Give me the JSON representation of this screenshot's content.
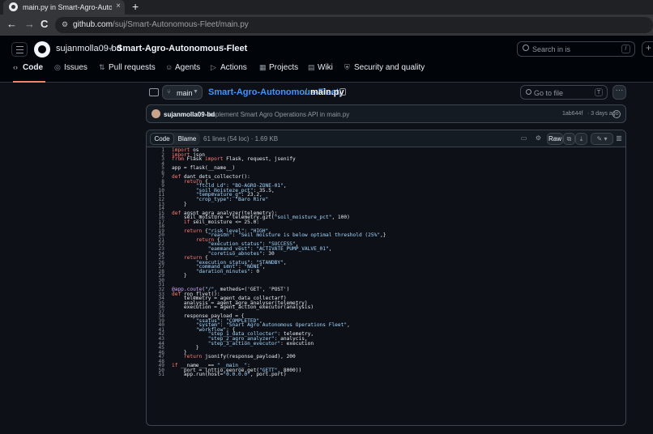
{
  "browser": {
    "tab_title": "main.py in Smart-Agro-Autonomous-Fleet",
    "tab_close": "×",
    "new_tab": "+",
    "url_host": "github.com",
    "url_path": "/suj/Smart-Autonomous-Fleet/main.py",
    "back": "←",
    "forward": "→",
    "reload": "C"
  },
  "header": {
    "owner": "sujanmolla09-bd",
    "separator": "/",
    "repo": "Smart-Agro-Autonomous-Fleet",
    "search_placeholder": "Search in is",
    "search_kbd": "/",
    "plus": "+"
  },
  "repo_tabs": [
    {
      "label": "Code",
      "icon": "‹›"
    },
    {
      "label": "Issues",
      "icon": "◎"
    },
    {
      "label": "Pull requests",
      "icon": "⇅"
    },
    {
      "label": "Agents",
      "icon": "☺"
    },
    {
      "label": "Actions",
      "icon": "▷"
    },
    {
      "label": "Projects",
      "icon": "▦"
    },
    {
      "label": "Wiki",
      "icon": "▤"
    },
    {
      "label": "Security and quality",
      "icon": "⛨"
    }
  ],
  "file_nav": {
    "branch": "main",
    "crumb_repo": "Smart-Agro-Autonomous-Fleet",
    "crumb_sep": "/",
    "crumb_file": "main.py",
    "goto_placeholder": "Go to file",
    "goto_kbd": "T",
    "more": "···"
  },
  "commit": {
    "author": "sujanmolla09-bd",
    "message": "Implement Smart Agro Operations API in main.py",
    "sha": "1ab644f",
    "time": "· 3 days ago"
  },
  "toolbar": {
    "code_label": "Code",
    "blame_label": "Blame",
    "file_info": "61 lines (54 loc) · 1.69 KB",
    "raw_label": "Raw"
  },
  "code": [
    {
      "n": "1",
      "t": "import os"
    },
    {
      "n": "2",
      "t": "import json"
    },
    {
      "n": "3",
      "t": "from Flask import Flask, request, jsenify"
    },
    {
      "n": "4",
      "t": ""
    },
    {
      "n": "5",
      "t": "app = flask(__name__)"
    },
    {
      "n": "6",
      "t": ""
    },
    {
      "n": "7",
      "t": "def dant_dets_collector():"
    },
    {
      "n": "8",
      "t": "    return {"
    },
    {
      "n": "9",
      "t": "        \"ftcld_Ld\": \"BO-AGRO-ZONE-01\","
    },
    {
      "n": "10",
      "t": "        \"soil_moisteze_pct\": 35.5,"
    },
    {
      "n": "11",
      "t": "        \"tempevature_g\": 23.2,"
    },
    {
      "n": "12",
      "t": "        \"crop_type\": \"Baro Rire\""
    },
    {
      "n": "13",
      "t": "    }"
    },
    {
      "n": "14",
      "t": ""
    },
    {
      "n": "15",
      "t": "def agsnt_agra_analyzer(telemetry):"
    },
    {
      "n": "16",
      "t": "    seil_moisture = telemetry.gzt(\"soil_moisture_pct\", 100)"
    },
    {
      "n": "17",
      "t": "    if seil_moisture <= 25.0:"
    },
    {
      "n": "18",
      "t": ""
    },
    {
      "n": "19",
      "t": "    return {\"risk_level\": \"HIGH\","
    },
    {
      "n": "20",
      "t": "            \"reason\": \"Seil moisture is below optimal threshold (25%\",}"
    },
    {
      "n": "21",
      "t": "        return {"
    },
    {
      "n": "22",
      "t": "            \"execution_status\": \"SUCCESS\","
    },
    {
      "n": "23",
      "t": "            \"eammand_vest\": \"ACTIVATE_PUMP_VALVE_01\","
    },
    {
      "n": "24",
      "t": "            \"coretiso_abnotes\": 30"
    },
    {
      "n": "25",
      "t": "    return {"
    },
    {
      "n": "26",
      "t": "        \"execution_status\": \"STANDBY\","
    },
    {
      "n": "27",
      "t": "        \"command_sent\": \"NONE\","
    },
    {
      "n": "28",
      "t": "        \"daration_minutes\": 0"
    },
    {
      "n": "29",
      "t": "    }"
    },
    {
      "n": "30",
      "t": ""
    },
    {
      "n": "31",
      "t": ""
    },
    {
      "n": "32",
      "t": "@app.coute(\"/\", metheds=('GET', 'POST')"
    },
    {
      "n": "33",
      "t": "def ron_flvet():"
    },
    {
      "n": "34",
      "t": "    telemetry = agent_data_collectarf)"
    },
    {
      "n": "35",
      "t": "    analysis = agent_agre_analyser(telemetry)"
    },
    {
      "n": "36",
      "t": "    execution = agent_action_executor(analysis)"
    },
    {
      "n": "37",
      "t": ""
    },
    {
      "n": "38",
      "t": "    response_payload = {"
    },
    {
      "n": "39",
      "t": "        \"ssatus\": \"COMPLETED\","
    },
    {
      "n": "40",
      "t": "        \"system\": \"Snart Agro Autonomous Operations Fleet\","
    },
    {
      "n": "41",
      "t": "        \"workflow\": {"
    },
    {
      "n": "42",
      "t": "            \"step_1_data_collocter\": telemetry,"
    },
    {
      "n": "43",
      "t": "            \"step_2_agro_analyzer\": analycis,"
    },
    {
      "n": "44",
      "t": "            \"step_3_action_evecutor\": execution"
    },
    {
      "n": "45",
      "t": "        }"
    },
    {
      "n": "46",
      "t": "    }"
    },
    {
      "n": "47",
      "t": "    return jsonify(response_payload), 200"
    },
    {
      "n": "48",
      "t": ""
    },
    {
      "n": "49",
      "t": "if __name__ == \"__main__\":"
    },
    {
      "n": "50",
      "t": "    port = lnttio.eenroe.get(\"GETT\", 8000))"
    },
    {
      "n": "51",
      "t": "    app.run(host=\"0.0.0.0\", port.port)"
    }
  ],
  "code_line_numbers": [
    "1",
    "2",
    "3",
    "4",
    "5",
    "6",
    "7",
    "8",
    "9",
    "10",
    "11",
    "12",
    "13",
    "14",
    "15",
    "16",
    "17",
    "18",
    "19",
    "20",
    "21",
    "22",
    "23",
    "24",
    "25",
    "26",
    "27",
    "28",
    "29",
    "30",
    "31",
    "32",
    "33",
    "34",
    "35",
    "36",
    "37",
    "38",
    "39",
    "40",
    "41",
    "42",
    "43",
    "44",
    "45",
    "46",
    "47",
    "48",
    "49",
    "50",
    "51"
  ],
  "colors": {
    "bg": "#0d1117",
    "header_bg": "#010409",
    "accent_link": "#4493f8",
    "tab_underline": "#f78166",
    "keyword": "#ff7b72",
    "string": "#a5d6ff",
    "function": "#d2a8ff",
    "number": "#79c0ff"
  }
}
